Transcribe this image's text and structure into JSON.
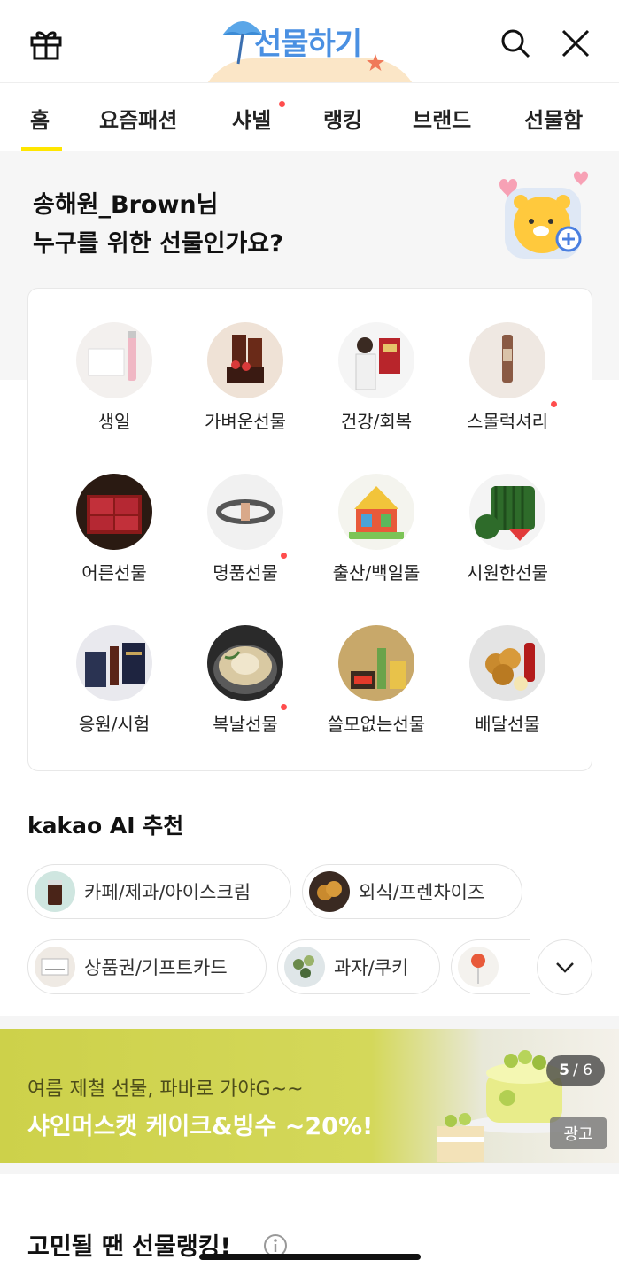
{
  "header": {
    "logo_text": "선물하기",
    "gift_icon": "gift-box-icon",
    "search_icon": "search-icon",
    "close_icon": "close-icon"
  },
  "tabs": [
    {
      "label": "홈",
      "active": true,
      "dot": false
    },
    {
      "label": "요즘패션",
      "active": false,
      "dot": false
    },
    {
      "label": "샤넬",
      "active": false,
      "dot": true
    },
    {
      "label": "랭킹",
      "active": false,
      "dot": false
    },
    {
      "label": "브랜드",
      "active": false,
      "dot": false
    },
    {
      "label": "선물함",
      "active": false,
      "dot": false
    }
  ],
  "greeting": {
    "line1": "송해원_Brown님",
    "line2": "누구를 위한 선물인가요?"
  },
  "categories": [
    {
      "label": "생일",
      "dot": false
    },
    {
      "label": "가벼운선물",
      "dot": false
    },
    {
      "label": "건강/회복",
      "dot": false
    },
    {
      "label": "스몰럭셔리",
      "dot": true
    },
    {
      "label": "어른선물",
      "dot": false
    },
    {
      "label": "명품선물",
      "dot": true
    },
    {
      "label": "출산/백일돌",
      "dot": false
    },
    {
      "label": "시원한선물",
      "dot": false
    },
    {
      "label": "응원/시험",
      "dot": false
    },
    {
      "label": "복날선물",
      "dot": true
    },
    {
      "label": "쓸모없는선물",
      "dot": false
    },
    {
      "label": "배달선물",
      "dot": false
    }
  ],
  "ai_section": {
    "brand": "kakao AI",
    "title": "추천",
    "chips": [
      {
        "label": "카페/제과/아이스크림"
      },
      {
        "label": "외식/프렌차이즈"
      },
      {
        "label": "상품권/기프트카드"
      },
      {
        "label": "과자/쿠키"
      },
      {
        "label": ""
      }
    ]
  },
  "banner": {
    "subtitle": "여름 제철 선물, 파바로 가야G~~",
    "title": "샤인머스캣 케이크&빙수 ~20%!",
    "pager_current": "5",
    "pager_total": "/ 6",
    "ad_label": "광고"
  },
  "ranking": {
    "title": "고민될 땐 선물랭킹!"
  },
  "colors": {
    "accent_yellow": "#ffe600",
    "logo_blue": "#4a90e2",
    "notify_red": "#ff4d4d"
  }
}
